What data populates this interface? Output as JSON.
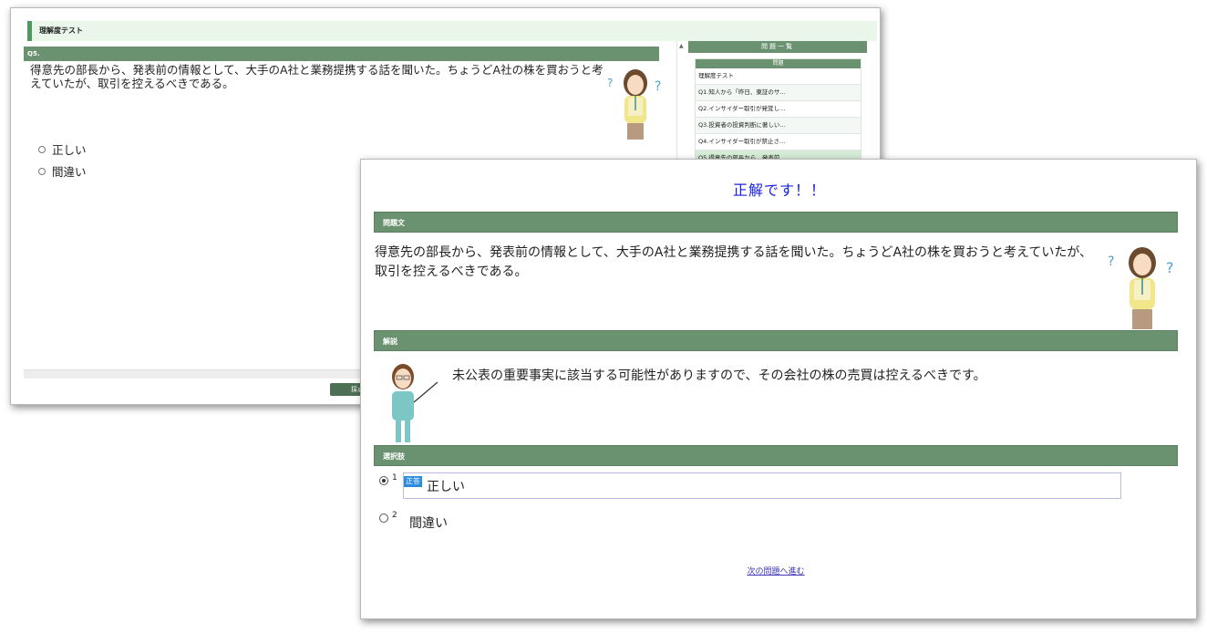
{
  "back_window": {
    "test_title": "理解度テスト",
    "question_header": "Q5.",
    "question_text": "得意先の部長から、発表前の情報として、大手のA社と業務提携する話を聞いた。ちょうどA社の株を買おうと考えていたが、取引を控えるべきである。",
    "options": [
      "正しい",
      "間違い"
    ],
    "sidebar_title": "問題一覧",
    "sidebar_sub": "問題",
    "sidebar_items": [
      "理解度テスト",
      "Q1.知人から「昨日、東証のサ...",
      "Q2.インサイダー取引が発覚し...",
      "Q3.投資者の投資判断に著しい...",
      "Q4.インサイダー取引が禁止さ...",
      "Q5.得意先の部長から、発表前..."
    ],
    "grade_button": "採点"
  },
  "front_window": {
    "result": "正解です！！",
    "question_section": "問題文",
    "question_text": "得意先の部長から、発表前の情報として、大手のA社と業務提携する話を聞いた。ちょうどA社の株を買おうと考えていたが、取引を控えるべきである。",
    "explanation_section": "解説",
    "explanation": "未公表の重要事実に該当する可能性がありますので、その会社の株の売買は控えるべきです。",
    "choices_section": "選択肢",
    "choices": [
      {
        "num": "1",
        "label": "正しい",
        "badge": "正答",
        "selected": true
      },
      {
        "num": "2",
        "label": "間違い",
        "selected": false
      }
    ],
    "next_link": "次の問題へ進む"
  },
  "colors": {
    "section_header": "#6a9270",
    "result_text": "#1a22dd",
    "badge": "#2a8be0"
  }
}
